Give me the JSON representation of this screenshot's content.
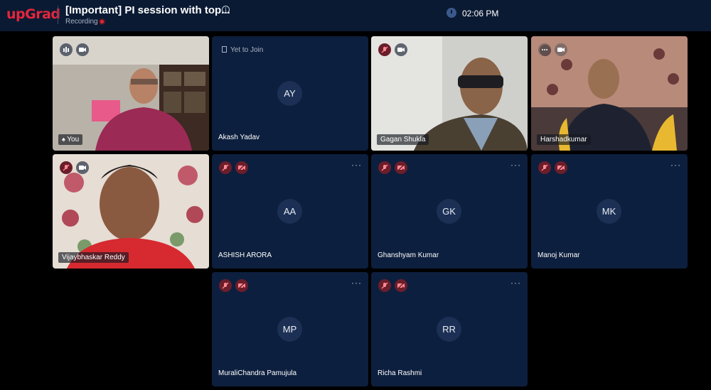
{
  "header": {
    "logo": "upGrad",
    "title": "[Important] PI session with top...",
    "recording_label": "Recording",
    "time": "02:06 PM"
  },
  "participants": [
    {
      "name": "You",
      "initials": "",
      "type": "video"
    },
    {
      "name": "Akash Yadav",
      "initials": "AY",
      "type": "waiting",
      "status": "Yet to Join"
    },
    {
      "name": "Gagan Shukla",
      "initials": "",
      "type": "video"
    },
    {
      "name": "Harshadkumar",
      "initials": "",
      "type": "video"
    },
    {
      "name": "Vijaybhaskar Reddy",
      "initials": "",
      "type": "video"
    },
    {
      "name": "ASHISH ARORA",
      "initials": "AA",
      "type": "avatar"
    },
    {
      "name": "Ghanshyam Kumar",
      "initials": "GK",
      "type": "avatar"
    },
    {
      "name": "Manoj Kumar",
      "initials": "MK",
      "type": "avatar"
    },
    {
      "name": "MuraliChandra Pamujula",
      "initials": "MP",
      "type": "avatar"
    },
    {
      "name": "Richa Rashmi",
      "initials": "RR",
      "type": "avatar"
    }
  ],
  "colors": {
    "brand": "#e5263b",
    "background": "#000000",
    "tile": "#0d1f3e",
    "header": "#0b1a33"
  },
  "icons": [
    "info-icon",
    "clock-icon",
    "mic-off-icon",
    "camera-off-icon",
    "camera-icon",
    "audio-level-icon",
    "more-icon",
    "person-icon",
    "door-icon"
  ]
}
